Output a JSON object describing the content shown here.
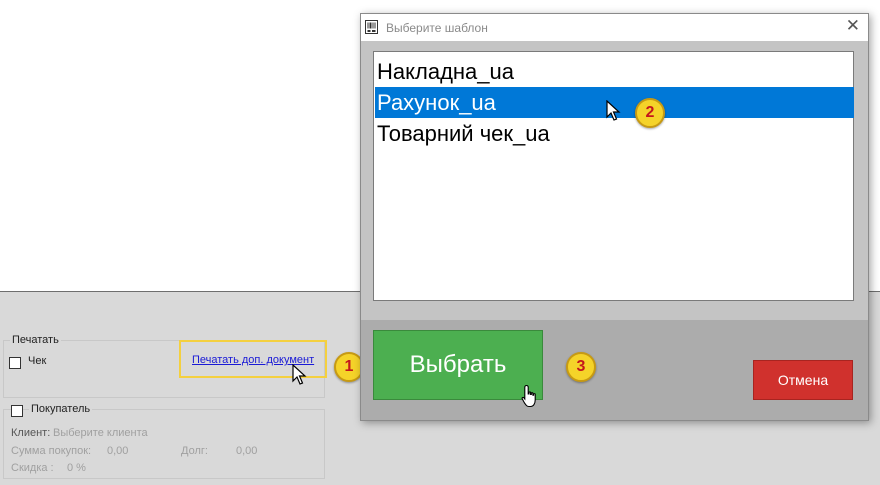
{
  "dialog": {
    "title": "Выберите шаблон",
    "close_glyph": "✕",
    "templates": [
      "Накладна_ua",
      "Рахунок_ua",
      "Товарний чек_ua"
    ],
    "selected_index": 1,
    "select_button": "Выбрать",
    "cancel_button": "Отмена"
  },
  "panel": {
    "print_group_label": "Печатать",
    "receipt_checkbox_label": "Чек",
    "print_extra_doc_link": "Печатать доп. документ",
    "buyer_checkbox_label": "Покупатель",
    "client_label": "Клиент:",
    "client_placeholder": "Выберите клиента",
    "purchases_sum_label": "Сумма покупок:",
    "purchases_sum_value": "0,00",
    "debt_label": "Долг:",
    "debt_value": "0,00",
    "discount_label": "Скидка :",
    "discount_value": "0 %"
  },
  "badges": [
    "1",
    "2",
    "3"
  ],
  "colors": {
    "select_button": "#4caf50",
    "cancel_button": "#d0312d",
    "selection": "#0078d7",
    "badge": "#f5d329",
    "highlight_frame": "#f4d03f"
  },
  "icons": {
    "app": "barcode-icon",
    "cursor_arrow": "arrow-cursor-icon",
    "cursor_hand": "hand-cursor-icon"
  }
}
